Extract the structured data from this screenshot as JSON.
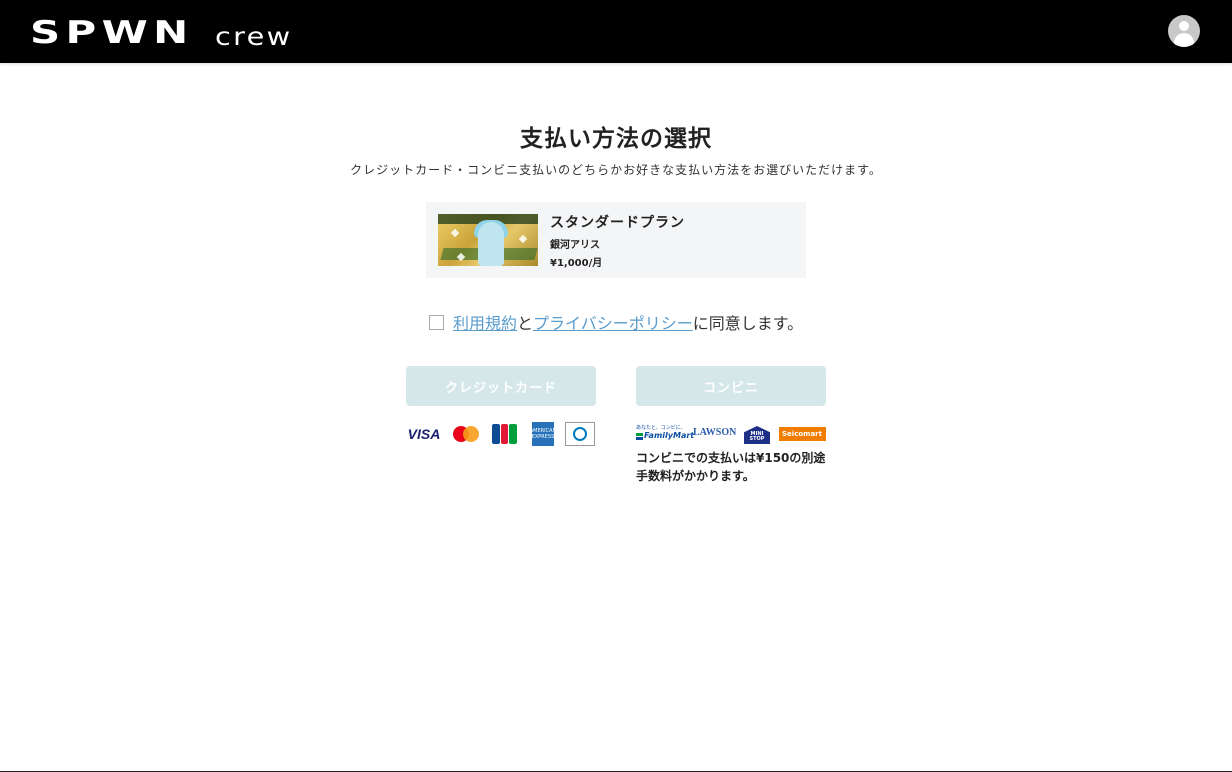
{
  "header": {
    "logo_main": "SPWN",
    "logo_sub": "crew"
  },
  "page": {
    "title": "支払い方法の選択",
    "subtitle": "クレジットカード・コンビニ支払いのどちらかお好きな支払い方法をお選びいただけます。"
  },
  "plan": {
    "name": "スタンダードプラン",
    "artist": "銀河アリス",
    "price": "¥1,000/月"
  },
  "agreement": {
    "terms_link": "利用規約",
    "connector": "と",
    "privacy_link": "プライバシーポリシー",
    "suffix": "に同意します。",
    "checked": false
  },
  "payment": {
    "credit_label": "クレジットカード",
    "convenience_label": "コンビニ",
    "card_brands": [
      "VISA",
      "Mastercard",
      "JCB",
      "AMERICAN EXPRESS",
      "Diners Club"
    ],
    "store_brands": [
      "FamilyMart",
      "LAWSON",
      "MINI STOP",
      "Seicomart"
    ],
    "visa_text": "VISA",
    "amex_text": "AMERICAN EXPRESS",
    "fm_top": "あなたと、コンビに、",
    "fm_text": "FamilyMart",
    "lawson_text": "LAWSON",
    "ministop_text": "MINI STOP",
    "seico_text": "Seicomart",
    "convenience_note": "コンビニでの支払いは¥150の別途手数料がかかります。"
  },
  "colors": {
    "header_bg": "#000000",
    "link": "#5a9ccc",
    "disabled_button": "#d5e7e8",
    "card_bg": "#f4f5f7"
  }
}
